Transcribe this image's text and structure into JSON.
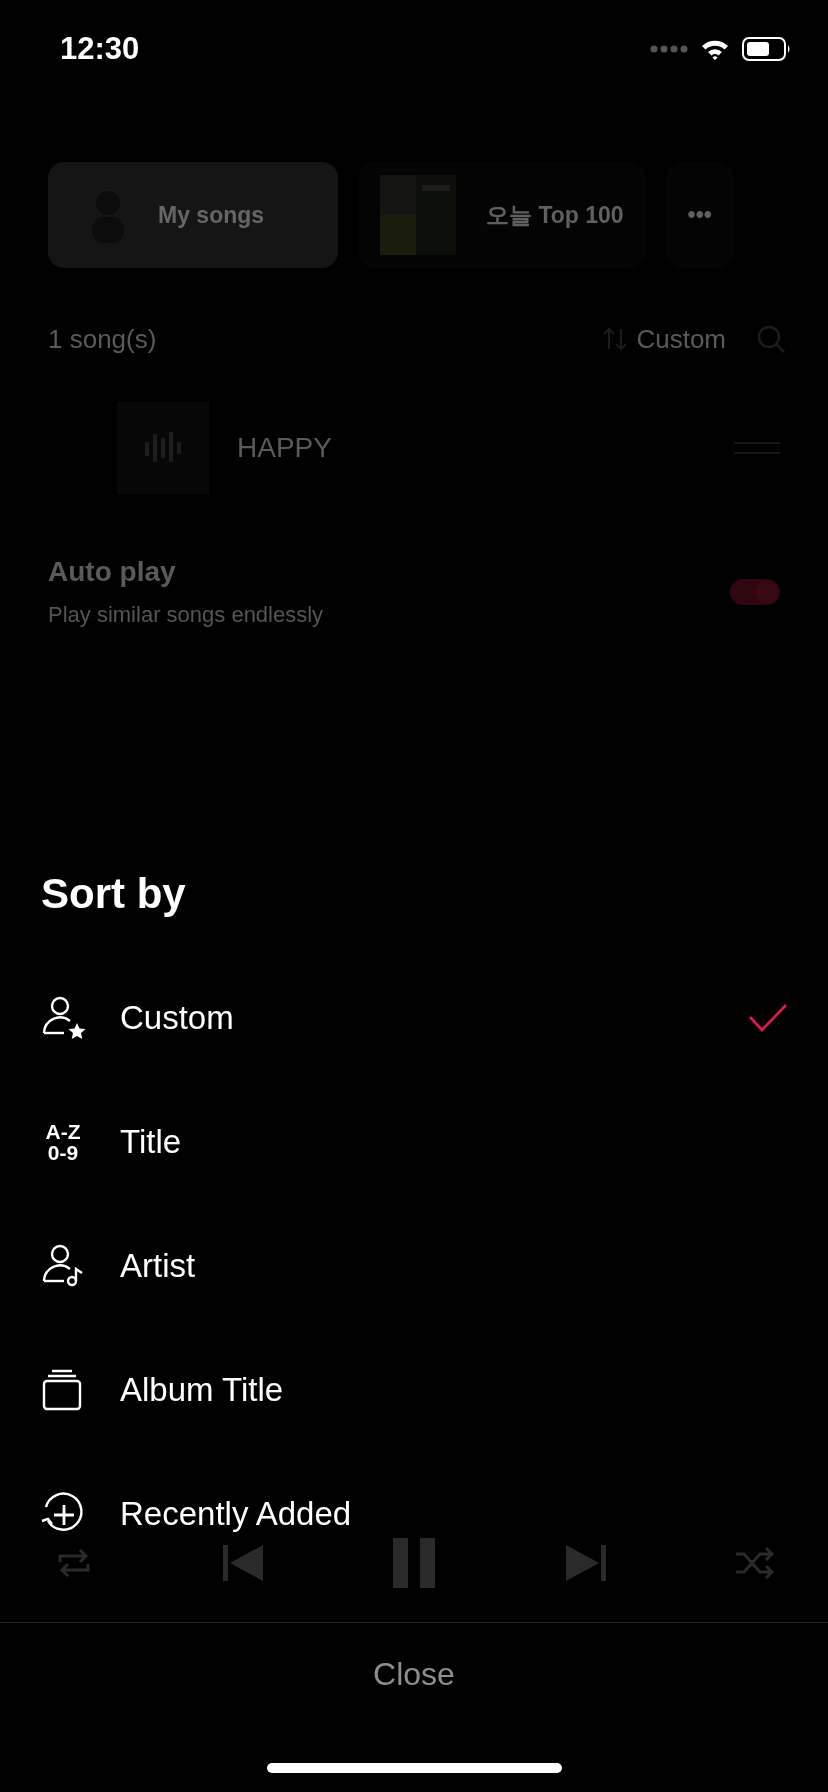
{
  "status_bar": {
    "time": "12:30"
  },
  "background": {
    "chips": [
      {
        "kind": "mine",
        "label": "My songs",
        "selected": true
      },
      {
        "kind": "album",
        "label": "오늘 Top 100",
        "selected": false
      },
      {
        "kind": "more",
        "label": "•••",
        "selected": false
      }
    ],
    "song_count": "1 song(s)",
    "sort_label": "Custom",
    "songs": [
      {
        "title": "HAPPY"
      }
    ],
    "auto_play": {
      "title": "Auto play",
      "subtitle": "Play similar songs endlessly",
      "on": true
    }
  },
  "sheet": {
    "title": "Sort by",
    "options": [
      {
        "kind": "custom",
        "label": "Custom",
        "selected": true
      },
      {
        "kind": "title",
        "label": "Title",
        "icon_text": [
          "A-Z",
          "0-9"
        ],
        "selected": false
      },
      {
        "kind": "artist",
        "label": "Artist",
        "selected": false
      },
      {
        "kind": "album",
        "label": "Album Title",
        "selected": false
      },
      {
        "kind": "recent",
        "label": "Recently Added",
        "selected": false
      }
    ],
    "close": "Close"
  }
}
